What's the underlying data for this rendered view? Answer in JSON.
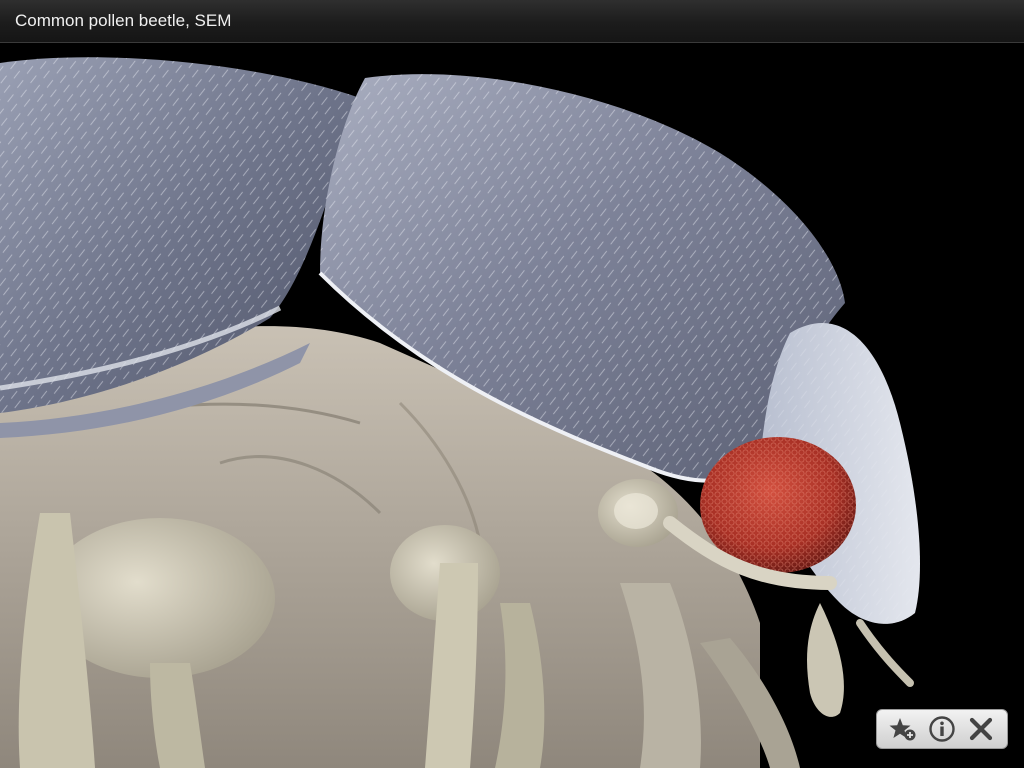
{
  "title_bar": {
    "title": "Common pollen beetle, SEM"
  },
  "photo": {
    "subject": "scanning-electron-micrograph-beetle",
    "colors": {
      "background": "#000000",
      "shell": "#7c8298",
      "body": "#b6aea2",
      "eye": "#b1342c"
    }
  },
  "toolbar": {
    "buttons": [
      {
        "icon": "star-add-icon"
      },
      {
        "icon": "info-icon"
      },
      {
        "icon": "close-icon"
      }
    ]
  }
}
